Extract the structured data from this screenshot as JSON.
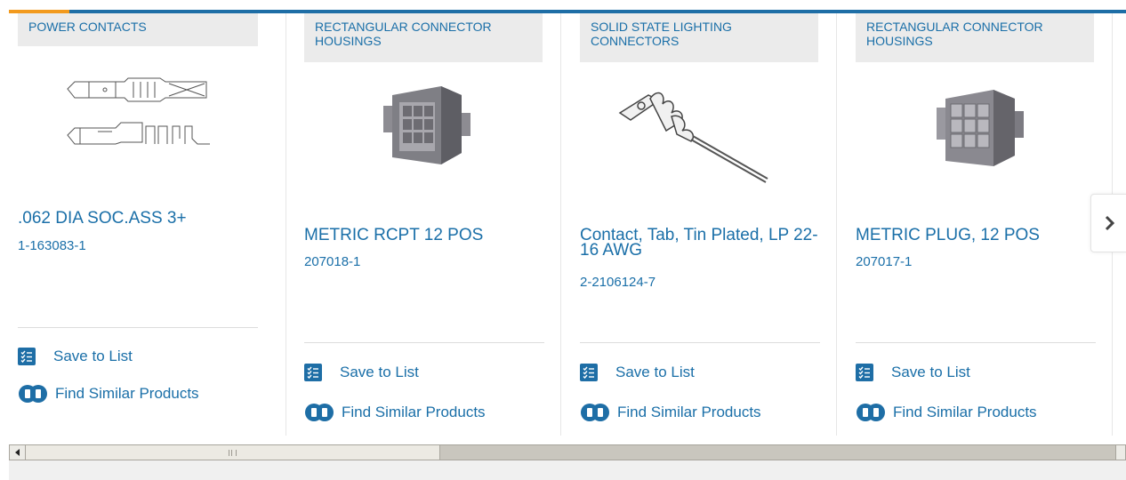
{
  "carousel": {
    "products": [
      {
        "category": "POWER CONTACTS",
        "name": ".062 DIA SOC.ASS 3+",
        "part_number": "1-163083-1",
        "image_icon": "power-contact-drawing",
        "save_label": "Save to List",
        "similar_label": "Find Similar Products"
      },
      {
        "category": "RECTANGULAR CONNECTOR HOUSINGS",
        "name": "METRIC RCPT 12 POS",
        "part_number": "207018-1",
        "image_icon": "rectangular-receptacle",
        "save_label": "Save to List",
        "similar_label": "Find Similar Products"
      },
      {
        "category": "SOLID STATE LIGHTING CONNECTORS",
        "name": "Contact, Tab, Tin Plated, LP 22-16 AWG",
        "part_number": "2-2106124-7",
        "image_icon": "tab-contact",
        "save_label": "Save to List",
        "similar_label": "Find Similar Products"
      },
      {
        "category": "RECTANGULAR CONNECTOR HOUSINGS",
        "name": "METRIC PLUG, 12 POS",
        "part_number": "207017-1",
        "image_icon": "rectangular-plug",
        "save_label": "Save to List",
        "similar_label": "Find Similar Products"
      }
    ],
    "next_icon": "chevron-right-icon"
  },
  "scrollbar": {
    "left_arrow_icon": "scroll-left-arrow-icon"
  },
  "colors": {
    "accent_blue": "#1e6ea6",
    "link_blue": "#1a6fa8",
    "accent_orange": "#f29a1e",
    "category_bg": "#ebebeb"
  }
}
